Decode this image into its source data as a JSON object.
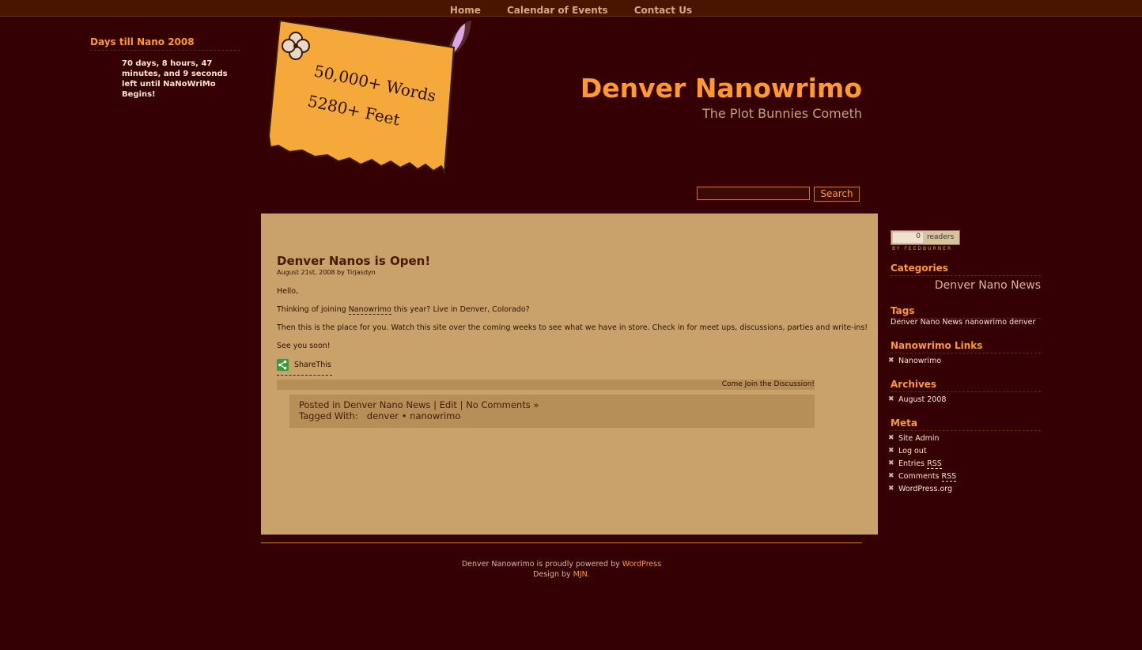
{
  "nav": {
    "items": [
      "Home",
      "Calendar of Events",
      "Contact Us"
    ]
  },
  "left_widget": {
    "title": "Days till Nano 2008",
    "countdown": "70 days, 8 hours, 47 minutes, and 9 seconds left until NaNoWriMo Begins!"
  },
  "sign": {
    "line1": "50,000+ Words",
    "line2": "5280+ Feet"
  },
  "header": {
    "title": "Denver Nanowrimo",
    "description": "The Plot Bunnies Cometh"
  },
  "search": {
    "button_label": "Search",
    "value": ""
  },
  "post": {
    "title": "Denver Nanos is Open!",
    "meta": "August 21st, 2008 by Tirjasdyn",
    "p1": "Hello,",
    "p2_before": "Thinking of joining ",
    "p2_link": "Nanowrimo",
    "p2_after": " this year? Live in Denver, Colorado?",
    "p3": "Then this is the place for you. Watch this site over the coming weeks to see what we have in store. Check in for meet ups, discussions, parties and write-ins!",
    "p4": "See you soon!",
    "share_label": "ShareThis",
    "discuss": "Come Join the Discussion!",
    "posted_in_label": "Posted in",
    "category": "Denver Nano News",
    "sep": "|",
    "edit": "Edit",
    "comments": "No Comments »",
    "tagged_label": "Tagged With:",
    "tags": [
      "denver",
      "nanowrimo"
    ],
    "tag_sep": "•"
  },
  "footer": {
    "line1_before": "Denver Nanowrimo is proudly powered by ",
    "line1_link": "WordPress",
    "line2_before": "Design by ",
    "line2_link": "MJN",
    "line2_after": "."
  },
  "sidebar": {
    "feedburner": {
      "count": "0",
      "label": "readers",
      "by": "BY FEEDBURNER"
    },
    "categories_title": "Categories",
    "category_big": "Denver Nano News",
    "tags_title": "Tags",
    "tags": "Denver Nano News nanowrimo denver",
    "links_title": "Nanowrimo Links",
    "links": [
      "Nanowrimo"
    ],
    "archives_title": "Archives",
    "archives": [
      "August 2008"
    ],
    "meta_title": "Meta",
    "meta": [
      "Site Admin",
      "Log out",
      "Entries",
      "Comments",
      "WordPress.org"
    ],
    "rss": "RSS"
  },
  "colors": {
    "background": "#350003",
    "accent": "#ff9a2c",
    "content_bg": "#c9a26b"
  }
}
